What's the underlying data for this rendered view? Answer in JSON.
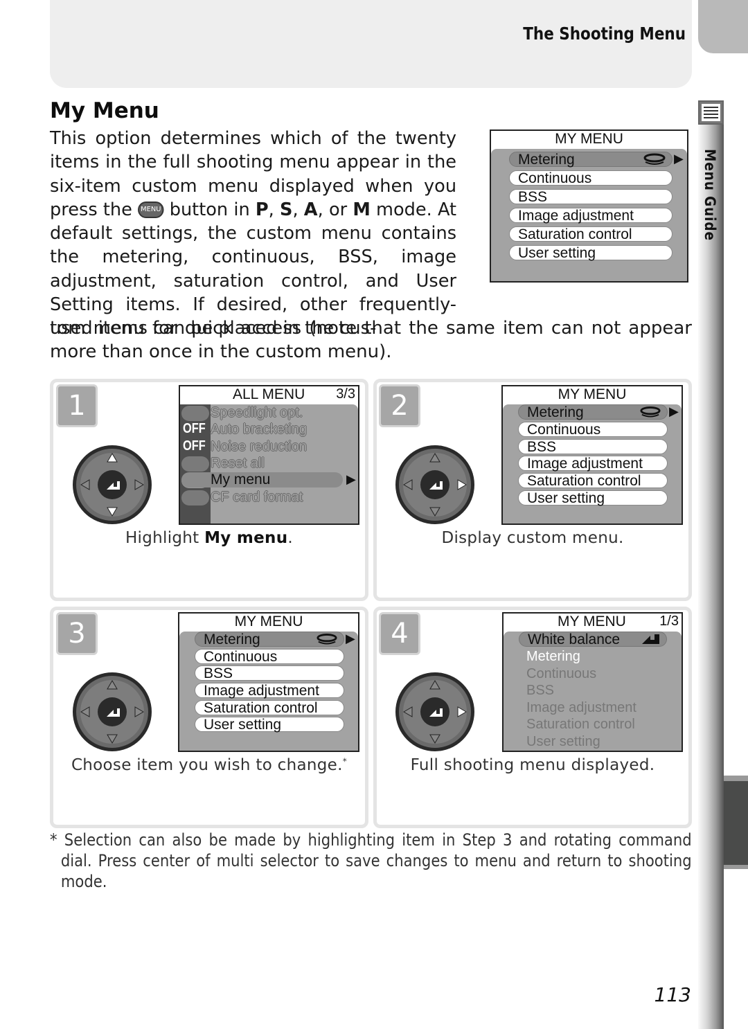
{
  "header": {
    "section_title": "The Shooting Menu"
  },
  "side_tab": {
    "label": "Menu Guide",
    "icon": "menu-list-icon"
  },
  "heading": "My Menu",
  "intro": {
    "part1": "This option determines which of the twenty items in the full shooting menu appear in the six-item custom menu displayed when you press the",
    "menu_button_label": "MENU",
    "part2": "button in",
    "modes": [
      "P",
      "S",
      "A",
      "M"
    ],
    "part3": "mode.  At default settings, the custom menu contains the metering, continuous, BSS, image adjustment, saturation control, and User Setting items.  If desired, other frequently-used items can be placed in the cus-",
    "part4": "tom menu for quick access (note that the same item can not appear more than once in the custom menu)."
  },
  "top_screen": {
    "title": "MY MENU",
    "items": [
      "Metering",
      "Continuous",
      "BSS",
      "Image adjustment",
      "Saturation control",
      "User setting"
    ],
    "highlighted": 0
  },
  "steps": [
    {
      "number": "1",
      "screen": {
        "title": "ALL MENU",
        "page": "3/3",
        "items": [
          {
            "label": "Speedlight opt.",
            "badge": ""
          },
          {
            "label": "Auto bracketing",
            "badge": "OFF"
          },
          {
            "label": "Noise reduction",
            "badge": "OFF"
          },
          {
            "label": "Reset all",
            "badge": ""
          },
          {
            "label": "My menu",
            "badge": ""
          },
          {
            "label": "CF card format",
            "badge": ""
          }
        ],
        "highlighted": 4
      },
      "caption_pre": "Highlight ",
      "caption_bold": "My menu",
      "caption_post": "."
    },
    {
      "number": "2",
      "screen": {
        "title": "MY MENU",
        "items": [
          "Metering",
          "Continuous",
          "BSS",
          "Image adjustment",
          "Saturation control",
          "User setting"
        ],
        "highlighted": 0
      },
      "caption": "Display custom menu."
    },
    {
      "number": "3",
      "screen": {
        "title": "MY MENU",
        "items": [
          "Metering",
          "Continuous",
          "BSS",
          "Image adjustment",
          "Saturation control",
          "User setting"
        ],
        "highlighted": 0
      },
      "caption": "Choose item you wish to change.",
      "caption_mark": "*"
    },
    {
      "number": "4",
      "screen": {
        "title": "MY MENU",
        "page": "1/3",
        "items": [
          "White balance",
          "Metering",
          "Continuous",
          "BSS",
          "Image adjustment",
          "Saturation control",
          "User setting"
        ],
        "highlighted": 0
      },
      "caption": "Full shooting menu displayed."
    }
  ],
  "footnote": {
    "mark": "*",
    "text": "Selection can also be made by highlighting item in Step 3 and rotating command dial.  Press center of multi selector to save changes to menu and return to shooting mode."
  },
  "page_number": "113"
}
